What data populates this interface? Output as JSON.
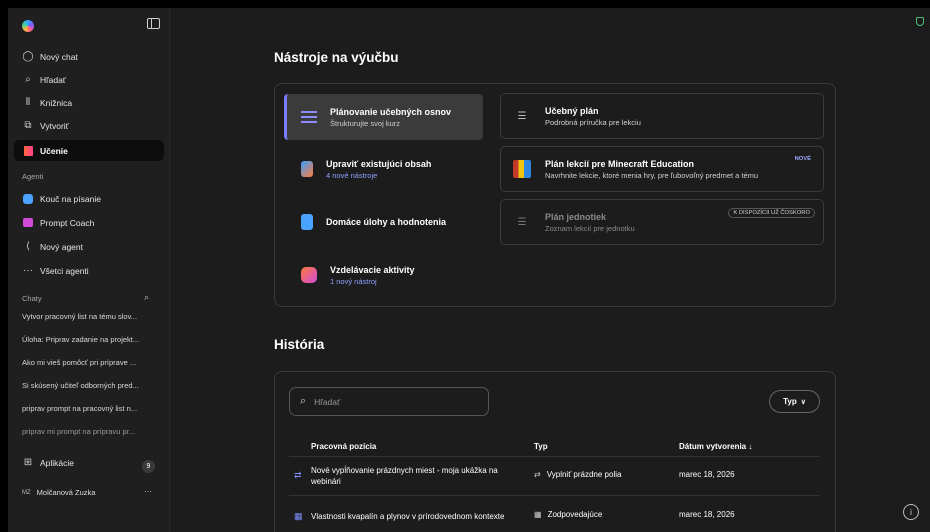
{
  "sidebar": {
    "nav": [
      {
        "label": "Nový chat",
        "icon": "chat-bubble-icon"
      },
      {
        "label": "Hľadať",
        "icon": "search-icon"
      },
      {
        "label": "Knižnica",
        "icon": "library-icon"
      },
      {
        "label": "Vytvoriť",
        "icon": "create-icon"
      },
      {
        "label": "Učenie",
        "icon": "book-icon"
      }
    ],
    "agents_label": "Agenti",
    "agents": [
      {
        "label": "Kouč na písanie",
        "icon": "writing-coach-icon"
      },
      {
        "label": "Prompt Coach",
        "icon": "prompt-coach-icon"
      },
      {
        "label": "Nový agent",
        "icon": "new-agent-icon"
      },
      {
        "label": "Všetci agenti",
        "icon": "more-icon"
      }
    ],
    "chats_label": "Chaty",
    "chats": [
      "Vytvor pracovný list na tému slov...",
      "Úloha: Priprav zadanie na projekt...",
      "Ako mi vieš pomôcť pri príprave ...",
      "Si skúsený učiteľ odborných pred...",
      "priprav prompt na pracovný list n...",
      "priprav mi prompt na prípravu pr..."
    ],
    "apps_label": "Aplikácie",
    "apps_count": "9",
    "user_initials": "MZ",
    "user_name": "Molčanová Zuzka",
    "user_more": "···"
  },
  "main": {
    "tools_title": "Nástroje na výučbu",
    "tools": [
      {
        "title": "Plánovanie učebných osnov",
        "subtitle": "Štrukturujte svoj kurz"
      },
      {
        "title": "Upraviť existujúci obsah",
        "subtitle": "4 nové nástroje"
      },
      {
        "title": "Domáce úlohy a hodnotenia",
        "subtitle": ""
      },
      {
        "title": "Vzdelávacie aktivity",
        "subtitle": "1 nový nástroj"
      }
    ],
    "cards": [
      {
        "title": "Učebný plán",
        "subtitle": "Podrobná príručka pre lekciu",
        "tag": ""
      },
      {
        "title": "Plán lekcií pre Minecraft Education",
        "subtitle": "Navrhnite lekcie, ktoré menia hry, pre ľubovoľný predmet a tému",
        "tag": "NOVÉ"
      },
      {
        "title": "Plán jednotiek",
        "subtitle": "Zoznam lekcií pre jednotku",
        "tag": "K DISPOZÍCII UŽ ČOSKORO"
      }
    ],
    "history_title": "História",
    "search_placeholder": "Hľadať",
    "type_filter": "Typ",
    "columns": [
      "Pracovná pozícia",
      "Typ",
      "Dátum vytvorenia ↓"
    ],
    "rows": [
      {
        "name": "Nové vypĺňovanie prázdnych miest - moja ukážka na webinári",
        "type": "Vyplniť prázdne polia",
        "date": "marec 18, 2026"
      },
      {
        "name": "Vlastnosti kvapalín a plynov v prírodovednom kontexte",
        "type": "Zodpovedajúce",
        "date": "marec 18, 2026"
      }
    ]
  },
  "colors": {
    "accent": "#7b7bff",
    "background": "#1c1c1c",
    "sidebar": "#1f1f1f"
  }
}
